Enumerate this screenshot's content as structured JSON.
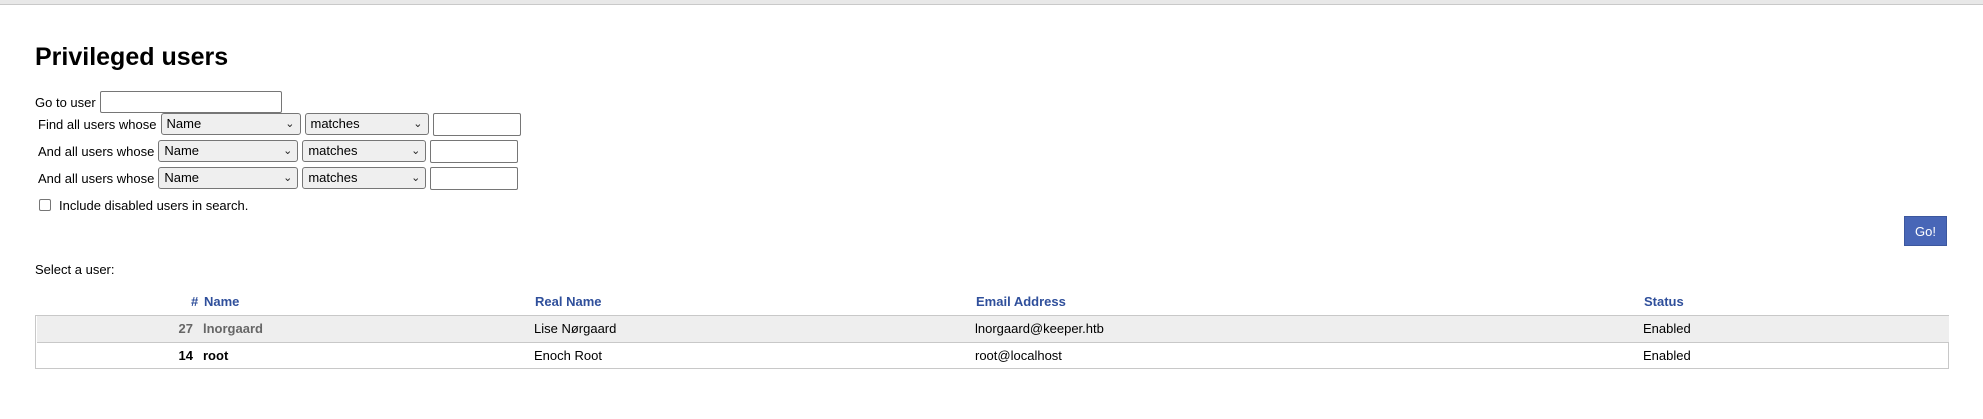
{
  "page": {
    "title": "Privileged users"
  },
  "search": {
    "goto_label": "Go to user",
    "goto_value": "",
    "rows": [
      {
        "label": "Find all users whose",
        "field": "Name",
        "operator": "matches",
        "value": ""
      },
      {
        "label": "And all users whose",
        "field": "Name",
        "operator": "matches",
        "value": ""
      },
      {
        "label": "And all users whose",
        "field": "Name",
        "operator": "matches",
        "value": ""
      }
    ],
    "include_disabled_label": "Include disabled users in search.",
    "include_disabled_checked": false,
    "go_label": "Go!"
  },
  "list": {
    "select_label": "Select a user:",
    "columns": {
      "id": "#",
      "name": "Name",
      "real_name": "Real Name",
      "email": "Email Address",
      "status": "Status"
    },
    "rows": [
      {
        "id": "27",
        "name": "lnorgaard",
        "real_name": "Lise Nørgaard",
        "email": "lnorgaard@keeper.htb",
        "status": "Enabled"
      },
      {
        "id": "14",
        "name": "root",
        "real_name": "Enoch Root",
        "email": "root@localhost",
        "status": "Enabled"
      }
    ]
  },
  "colors": {
    "accent": "#4866b7",
    "header_link": "#2f4f9b",
    "row_alt": "#eeeeee"
  }
}
